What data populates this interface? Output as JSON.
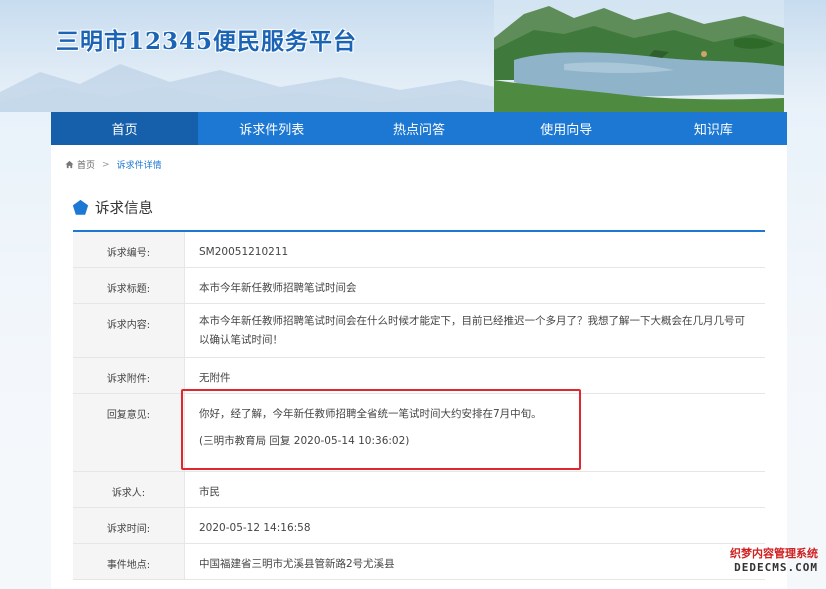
{
  "header": {
    "site_title": "三明市12345便民服务平台"
  },
  "nav": {
    "items": [
      {
        "label": "首页",
        "active": true
      },
      {
        "label": "诉求件列表",
        "active": false
      },
      {
        "label": "热点问答",
        "active": false
      },
      {
        "label": "使用向导",
        "active": false
      },
      {
        "label": "知识库",
        "active": false
      }
    ]
  },
  "breadcrumb": {
    "home": "首页",
    "current": "诉求件详情"
  },
  "section": {
    "title": "诉求信息"
  },
  "fields": {
    "number": {
      "label": "诉求编号:",
      "value": "SM20051210211"
    },
    "title": {
      "label": "诉求标题:",
      "value": "本市今年新任教师招聘笔试时间会"
    },
    "content": {
      "label": "诉求内容:",
      "value": "本市今年新任教师招聘笔试时间会在什么时候才能定下，目前已经推迟一个多月了？我想了解一下大概会在几月几号可以确认笔试时间！"
    },
    "attachment": {
      "label": "诉求附件:",
      "value": "无附件"
    },
    "reply": {
      "label": "回复意见:",
      "value": "你好，经了解，今年新任教师招聘全省统一笔试时间大约安排在7月中旬。",
      "signature": "(三明市教育局 回复 2020-05-14 10:36:02)"
    },
    "person": {
      "label": "诉求人:",
      "value": "市民"
    },
    "time": {
      "label": "诉求时间:",
      "value": "2020-05-12 14:16:58"
    },
    "location": {
      "label": "事件地点:",
      "value": "中国福建省三明市尤溪县管新路2号尤溪县"
    }
  },
  "watermark": {
    "line1": "织梦内容管理系统",
    "line2": "DEDECMS.COM"
  },
  "colors": {
    "nav": "#1d78d3",
    "nav_active": "#155fab",
    "title": "#1b63b4",
    "highlight_box": "#e2262d"
  }
}
